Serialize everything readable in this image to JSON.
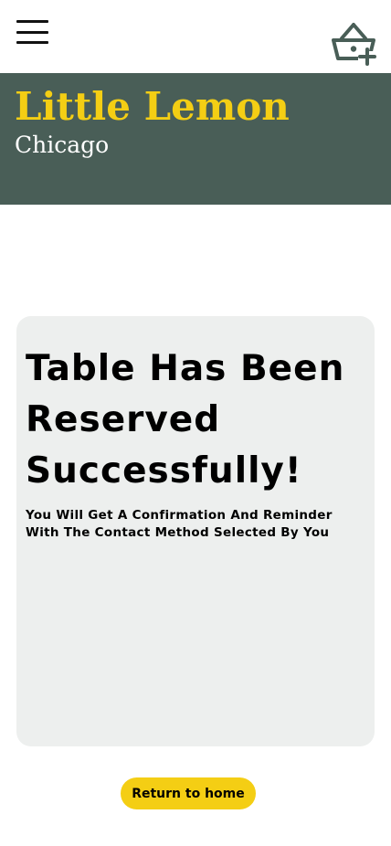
{
  "header": {
    "menu_icon": "hamburger-menu-icon",
    "cart_icon": "basket-add-icon"
  },
  "hero": {
    "title": "Little Lemon",
    "subtitle": "Chicago"
  },
  "confirmation": {
    "heading": "Table Has Been Reserved Successfully!",
    "message": "You Will Get A Confirmation And Reminder With The Contact Method Selected By You"
  },
  "actions": {
    "return_home_label": "Return to home"
  },
  "colors": {
    "brand_green": "#495e57",
    "brand_yellow": "#f4ce14",
    "card_background": "#edefee"
  }
}
